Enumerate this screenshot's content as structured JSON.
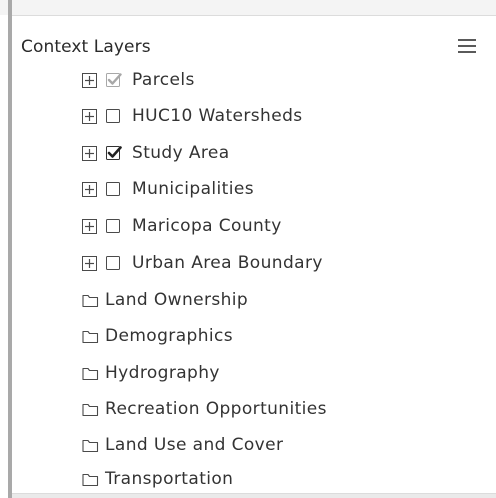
{
  "panel": {
    "title": "Context Layers",
    "menu_icon": "hamburger-menu-icon"
  },
  "layers": [
    {
      "label": "Parcels",
      "checked": true,
      "check_style": "disabled",
      "expand_icon": "plus-box-icon",
      "check_icon": "checkbox-checked-disabled-icon"
    },
    {
      "label": "HUC10 Watersheds",
      "checked": false,
      "check_style": "normal",
      "expand_icon": "plus-box-icon",
      "check_icon": "checkbox-unchecked-icon"
    },
    {
      "label": "Study Area",
      "checked": true,
      "check_style": "normal",
      "expand_icon": "plus-box-icon",
      "check_icon": "checkbox-checked-icon"
    },
    {
      "label": "Municipalities",
      "checked": false,
      "check_style": "normal",
      "expand_icon": "plus-box-icon",
      "check_icon": "checkbox-unchecked-icon"
    },
    {
      "label": "Maricopa County",
      "checked": false,
      "check_style": "normal",
      "expand_icon": "plus-box-icon",
      "check_icon": "checkbox-unchecked-icon"
    },
    {
      "label": "Urban Area Boundary",
      "checked": false,
      "check_style": "normal",
      "expand_icon": "plus-box-icon",
      "check_icon": "checkbox-unchecked-icon"
    }
  ],
  "groups": [
    {
      "label": "Land Ownership",
      "icon": "folder-icon"
    },
    {
      "label": "Demographics",
      "icon": "folder-icon"
    },
    {
      "label": "Hydrography",
      "icon": "folder-icon"
    },
    {
      "label": "Recreation Opportunities",
      "icon": "folder-icon"
    },
    {
      "label": "Land Use and Cover",
      "icon": "folder-icon"
    },
    {
      "label": "Transportation",
      "icon": "folder-icon"
    }
  ],
  "colors": {
    "text": "#333333",
    "icon": "#4a4a4a",
    "disabled_check": "#a8a8a8",
    "rail": "#a9a9a9"
  }
}
